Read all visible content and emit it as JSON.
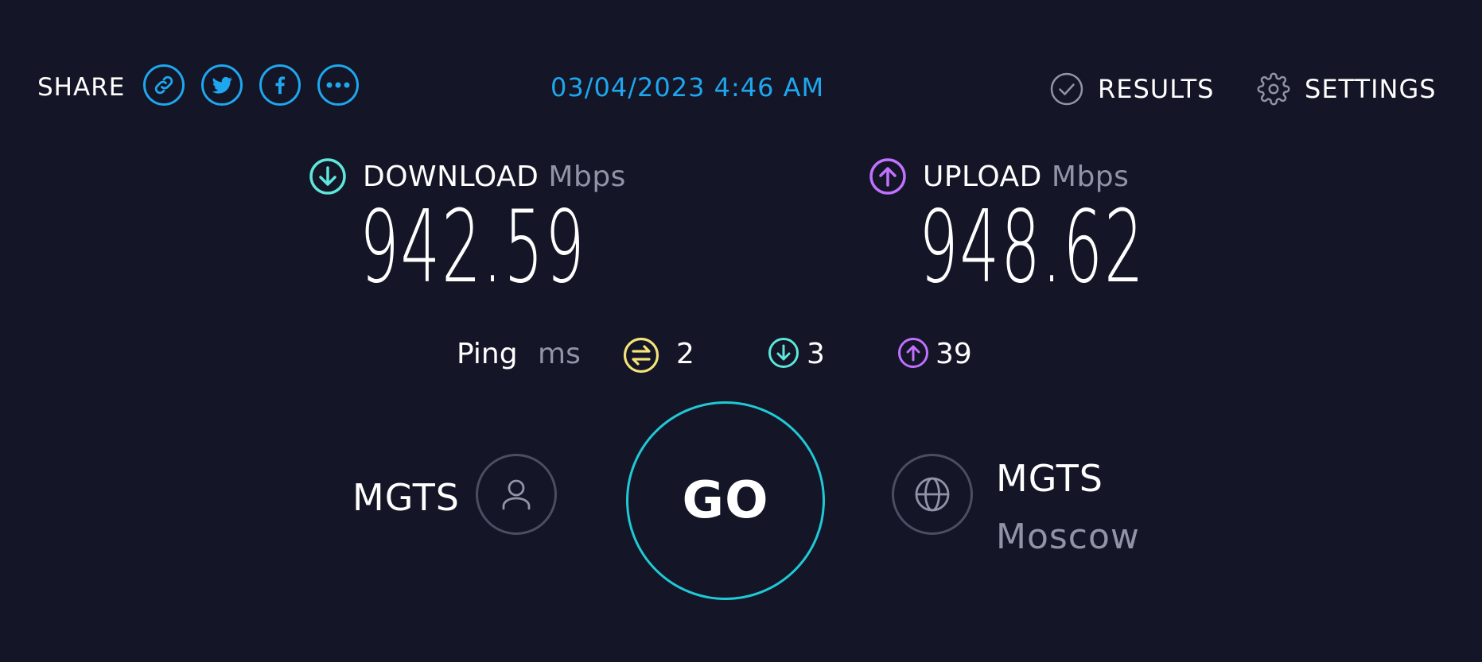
{
  "header": {
    "share_label": "SHARE",
    "share_buttons": [
      {
        "icon": "link-icon"
      },
      {
        "icon": "twitter-icon"
      },
      {
        "icon": "facebook-icon"
      },
      {
        "icon": "more-icon"
      }
    ],
    "timestamp": "03/04/2023 4:46 AM",
    "results_label": "RESULTS",
    "settings_label": "SETTINGS"
  },
  "download": {
    "label": "DOWNLOAD",
    "unit": "Mbps",
    "value": "942.59"
  },
  "upload": {
    "label": "UPLOAD",
    "unit": "Mbps",
    "value": "948.62"
  },
  "ping": {
    "label": "Ping",
    "unit": "ms",
    "idle": "2",
    "download": "3",
    "upload": "39"
  },
  "isp": {
    "name": "MGTS"
  },
  "go": {
    "label": "GO"
  },
  "server": {
    "name": "MGTS",
    "city": "Moscow"
  },
  "colors": {
    "background": "#141526",
    "accent_blue": "#1ea7ee",
    "download_teal": "#5ee6db",
    "upload_purple": "#bf71ff",
    "ping_yellow": "#f4e27a",
    "muted_text": "#9193a8",
    "go_ring": "#1fc9d5"
  }
}
